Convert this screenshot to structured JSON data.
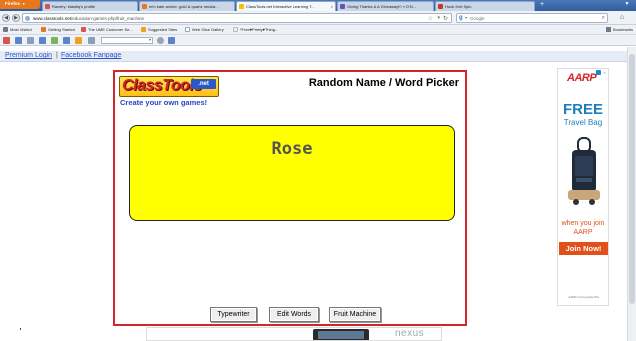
{
  "browser": {
    "app_button_label": "Firefox",
    "tabs": [
      {
        "title": "Ravelry: ktawfiq's profile",
        "active": false,
        "favicon_color": "#d9534f"
      },
      {
        "title": "erin kate archer: gold & quartz neckla...",
        "active": false,
        "favicon_color": "#e8761a"
      },
      {
        "title": "ClassTools.net Interactive Learning T...",
        "active": true,
        "favicon_color": "#f5c400"
      },
      {
        "title": "Giving Thanks & A Giveaway!!! « D'N...",
        "active": false,
        "favicon_color": "#6a4fb3"
      },
      {
        "title": "Hook Knit Spin",
        "active": false,
        "favicon_color": "#c0392b"
      }
    ],
    "new_tab_label": "+",
    "url_host": "www.classtools.net",
    "url_path": "/education-games-php/fruit_machine",
    "search_engine": "Google",
    "search_placeholder": "Google",
    "bookmarks": [
      {
        "label": "Most Visited",
        "icon": "star-folder-icon",
        "color": "#6b7b8e"
      },
      {
        "label": "Getting Started",
        "icon": "firefox-icon",
        "color": "#e8761a"
      },
      {
        "label": "The UME Customer Se...",
        "icon": "mail-icon",
        "color": "#d9534f"
      },
      {
        "label": "Suggested Sites",
        "icon": "sites-icon",
        "color": "#f0a020"
      },
      {
        "label": "Web Slice Gallery",
        "icon": "slice-icon",
        "color": "#9aa5b3"
      },
      {
        "label": "*Free♥Pretty♥Thing...",
        "icon": "page-icon",
        "color": "#cccccc"
      }
    ],
    "bookmarks_menu_label": "Bookmarks"
  },
  "page": {
    "top_links": [
      "Premium Login",
      "|",
      "Facebook Fanpage"
    ],
    "classtools": {
      "logo_text": "ClassTools",
      "logo_badge": ".net",
      "tagline": "Create your own games!",
      "title": "Random Name / Word Picker",
      "current_word": "Rose",
      "card_color": "#ffff00",
      "buttons": [
        "Typewriter",
        "Edit Words",
        "Fruit Machine"
      ]
    },
    "ad": {
      "brand": "AARP",
      "headline": "FREE",
      "subline": "Travel Bag",
      "when_text": "when you join AARP",
      "cta": "Join Now!",
      "fine_print": "AARP is for people 50+",
      "brand_color": "#d4252a",
      "accent_color": "#1b7fbf",
      "cta_color": "#e2501a"
    },
    "bottom_banner": {
      "brand": "nexus"
    }
  }
}
